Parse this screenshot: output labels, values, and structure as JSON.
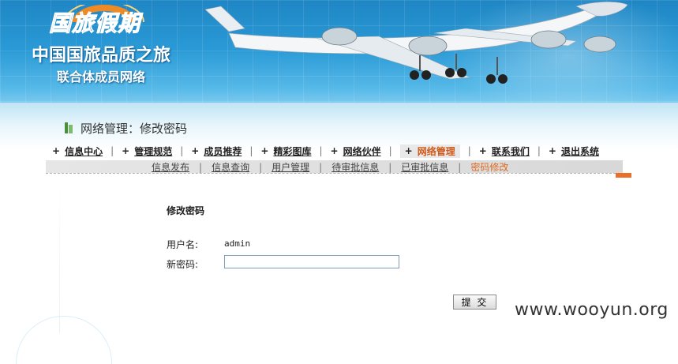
{
  "banner": {
    "logo_text": "国旅假期",
    "slogan_line1": "中国国旅品质之旅",
    "slogan_line2": "联合体成员网络"
  },
  "page_title": "网络管理：修改密码",
  "main_nav": {
    "items": [
      {
        "label": "信息中心",
        "active": false
      },
      {
        "label": "管理规范",
        "active": false
      },
      {
        "label": "成员推荐",
        "active": false
      },
      {
        "label": "精彩图库",
        "active": false
      },
      {
        "label": "网络伙伴",
        "active": false
      },
      {
        "label": "网络管理",
        "active": true
      },
      {
        "label": "联系我们",
        "active": false
      },
      {
        "label": "退出系统",
        "active": false
      }
    ]
  },
  "sub_nav": {
    "items": [
      {
        "label": "信息发布",
        "active": false
      },
      {
        "label": "信息查询",
        "active": false
      },
      {
        "label": "用户管理",
        "active": false
      },
      {
        "label": "待审批信息",
        "active": false
      },
      {
        "label": "已审批信息",
        "active": false
      },
      {
        "label": "密码修改",
        "active": true
      }
    ]
  },
  "form": {
    "title": "修改密码",
    "username_label": "用户名:",
    "username_value": "admin",
    "password_label": "新密码:",
    "password_value": "",
    "submit_label": "提 交"
  },
  "watermark": "www.wooyun.org",
  "colors": {
    "accent_orange": "#e06a20",
    "banner_blue": "#2a9ad6"
  }
}
